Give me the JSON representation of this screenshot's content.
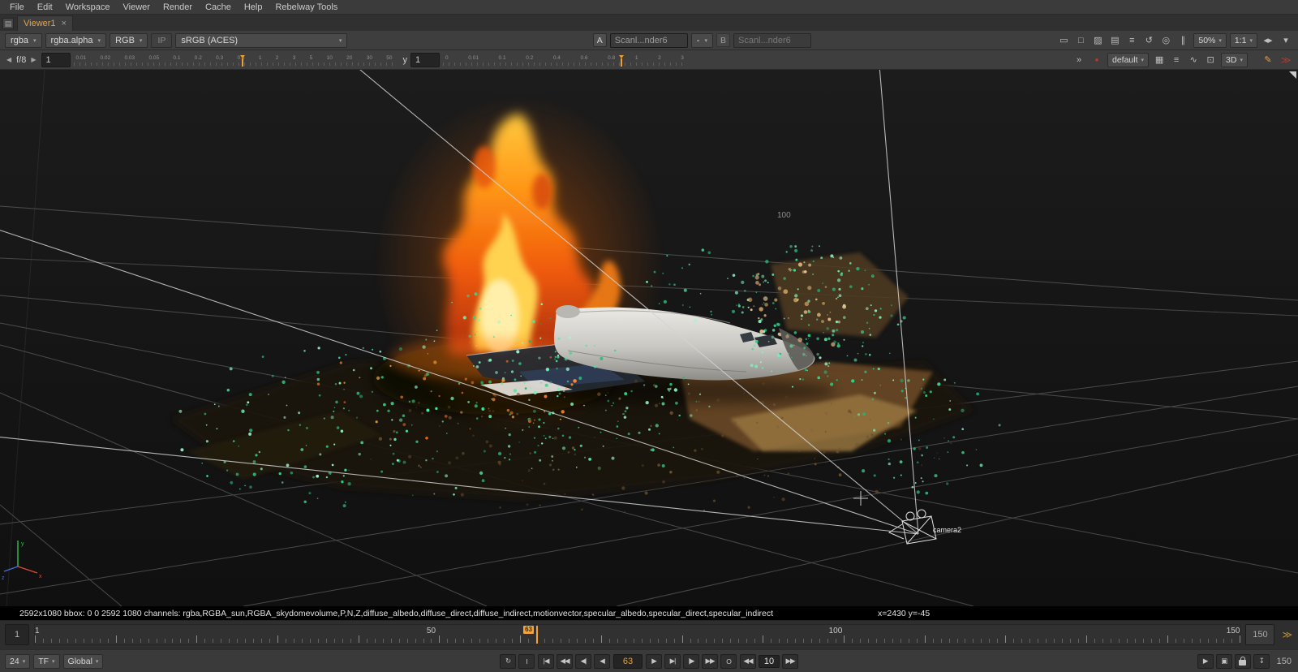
{
  "colors": {
    "accent": "#f0a030",
    "tab_text": "#e8a33d",
    "playhead": "#f7a233",
    "error_red": "#c0392b",
    "point_green": "#45e09a"
  },
  "menubar": {
    "items": [
      {
        "name": "menu-file",
        "label": "File"
      },
      {
        "name": "menu-edit",
        "label": "Edit"
      },
      {
        "name": "menu-workspace",
        "label": "Workspace"
      },
      {
        "name": "menu-viewer",
        "label": "Viewer"
      },
      {
        "name": "menu-render",
        "label": "Render"
      },
      {
        "name": "menu-cache",
        "label": "Cache"
      },
      {
        "name": "menu-help",
        "label": "Help"
      },
      {
        "name": "menu-rebelway-tools",
        "label": "Rebelway Tools"
      }
    ]
  },
  "tabs": {
    "active": "Viewer1",
    "close_glyph": "×"
  },
  "viewer_toolbar": {
    "layer_dropdown": "rgba",
    "alpha_dropdown": "rgba.alpha",
    "display_channels": "RGB",
    "input_process": "IP",
    "viewer_process": "sRGB (ACES)",
    "a_label": "A",
    "a_source": "Scanl...nder6",
    "ab_blend": "-",
    "b_label": "B",
    "b_source": "Scanl...nder6",
    "icons": [
      {
        "name": "wipe-mode-icon",
        "glyph": "▭"
      },
      {
        "name": "full-frame-icon",
        "glyph": "□"
      },
      {
        "name": "checker-background-icon",
        "glyph": "▨"
      },
      {
        "name": "monitor-out-icon",
        "glyph": "▤"
      },
      {
        "name": "overlay-menu-icon",
        "glyph": "≡"
      },
      {
        "name": "refresh-icon",
        "glyph": "↺"
      },
      {
        "name": "center-view-icon",
        "glyph": "◎"
      },
      {
        "name": "pause-updates-icon",
        "glyph": "∥"
      }
    ],
    "zoom_level": "50%",
    "pixel_aspect": "1:1",
    "spin_glyph": "◂▸",
    "menu_chevron": "▾"
  },
  "exposure_toolbar": {
    "prev_glyph": "◀",
    "fstop": "f/8",
    "next_glyph": "▶",
    "gain_value": "1",
    "gain_ticks": [
      "0.01",
      "0.02",
      "0.03",
      "0.05",
      "0.1",
      "0.2",
      "0.3",
      "0.5",
      "1",
      "2",
      "3",
      "5",
      "10",
      "20",
      "30",
      "50"
    ],
    "gamma_label": "y",
    "gamma_value": "1",
    "gamma_ticks": [
      "0",
      "0.01",
      "0.1",
      "0.2",
      "0.4",
      "0.6",
      "0.8",
      "1",
      "2",
      "3"
    ],
    "stereo_glyph": "»",
    "error_glyph": "●",
    "layout_dropdown": "default",
    "right_icons": [
      {
        "name": "lut-grid-icon",
        "glyph": "▦"
      },
      {
        "name": "row-layout-icon",
        "glyph": "≡"
      },
      {
        "name": "waveform-icon",
        "glyph": "∿"
      },
      {
        "name": "marquee-select-icon",
        "glyph": "⊡"
      }
    ],
    "view_mode": "3D",
    "pencil_glyph": "✎",
    "lock_chevrons_glyph": "≫"
  },
  "viewport": {
    "grid_label": "100",
    "camera_label": "camera2",
    "axis_x": "x",
    "axis_y": "y",
    "axis_z": "z"
  },
  "status_bar": {
    "info": "2592x1080 bbox: 0 0 2592 1080 channels: rgba,RGBA_sun,RGBA_skydomevolume,P,N,Z,diffuse_albedo,diffuse_direct,diffuse_indirect,motionvector,specular_albedo,specular_direct,specular_indirect",
    "cursor": "x=2430 y=-45"
  },
  "timeline": {
    "range_start": "1",
    "range_end": "150",
    "first": 1,
    "last": 150,
    "current": 63,
    "labels": [
      {
        "frame": 1,
        "text": "1"
      },
      {
        "frame": 50,
        "text": "50"
      },
      {
        "frame": 100,
        "text": "100"
      },
      {
        "frame": 150,
        "text": "150"
      }
    ],
    "expand_glyph": "≫"
  },
  "transport": {
    "fps": "24",
    "timeline_mode": "TF",
    "range_mode": "Global",
    "left_buttons": [
      {
        "name": "playback-mode-button",
        "glyph": "↻"
      },
      {
        "name": "range-lock-button",
        "glyph": "I"
      }
    ],
    "back_buttons": [
      {
        "name": "goto-start-button",
        "glyph": "|◀"
      },
      {
        "name": "play-backward-button",
        "glyph": "◀◀"
      },
      {
        "name": "prev-increment-button",
        "glyph": "◀|"
      },
      {
        "name": "step-back-button",
        "glyph": "◀"
      }
    ],
    "current_frame": "63",
    "fwd_buttons": [
      {
        "name": "play-forward-button",
        "glyph": "▶"
      },
      {
        "name": "step-forward-button",
        "glyph": "▶|"
      },
      {
        "name": "next-increment-button",
        "glyph": "|▶"
      },
      {
        "name": "goto-end-button",
        "glyph": "▶▶"
      },
      {
        "name": "loop-button",
        "glyph": "O"
      }
    ],
    "inc_back_glyph": "◀◀",
    "increment": "10",
    "inc_fwd_glyph": "▶▶",
    "right_icons": [
      {
        "name": "flipbook-button",
        "glyph": "▶"
      },
      {
        "name": "render-button",
        "glyph": "▣"
      },
      {
        "name": "lock-range-button",
        "cls": "lock-shape"
      },
      {
        "name": "save-button",
        "glyph": "↧"
      }
    ],
    "end_frame": "150"
  }
}
